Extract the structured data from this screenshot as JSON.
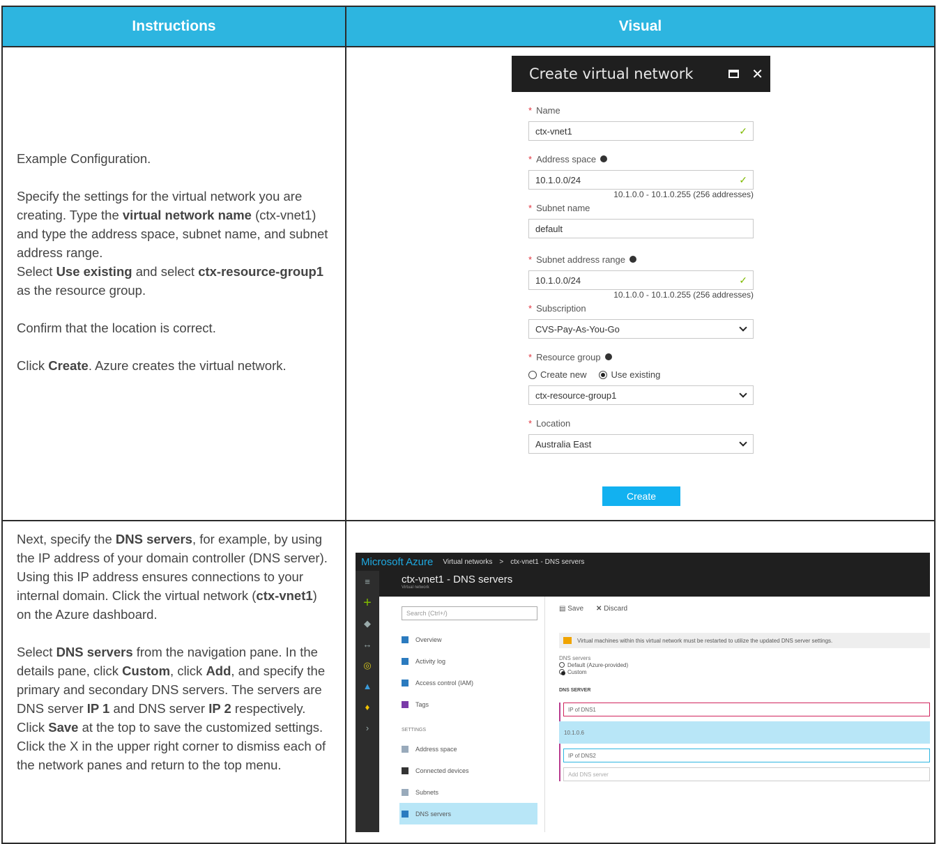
{
  "table": {
    "header": {
      "instructions": "Instructions",
      "visual": "Visual"
    },
    "row1": {
      "p1": "Example Configuration.",
      "p2_a": "Specify the settings for the virtual network you are creating. Type the ",
      "p2_b": "virtual network name",
      "p2_c": " (ctx-vnet1) and type the address space, subnet name, and subnet address range.",
      "p3_a": "Select ",
      "p3_b": "Use existing",
      "p3_c": " and select ",
      "p3_d": "ctx-resource-group1",
      "p3_e": " as the resource group.",
      "p4": "Confirm that the location is correct.",
      "p5_a": "Click ",
      "p5_b": "Create",
      "p5_c": ". Azure creates the virtual network."
    },
    "row2": {
      "p1_a": "Next, specify the ",
      "p1_b": "DNS servers",
      "p1_c": ", for example, by using the IP address of your domain controller (DNS server). Using this IP address ensures connections to your internal domain. Click the virtual network (",
      "p1_d": "ctx-vnet1",
      "p1_e": ") on the Azure dashboard.",
      "p2_a": "Select ",
      "p2_b": "DNS servers",
      "p2_c": " from the navigation pane. In the details pane, click ",
      "p2_d": "Custom",
      "p2_e": ", click ",
      "p2_f": "Add",
      "p2_g": ", and specify the primary and secondary DNS servers. The servers are DNS server ",
      "p2_h": "IP 1",
      "p2_i": " and DNS server ",
      "p2_j": "IP 2",
      "p2_k": " respectively. Click ",
      "p2_l": "Save",
      "p2_m": " at the top to save the customized settings. Click the X in the upper right corner to dismiss each of the network panes and return to the top menu."
    }
  },
  "create_panel": {
    "title": "Create virtual network",
    "name_label": "Name",
    "name_value": "ctx-vnet1",
    "address_label": "Address space",
    "address_value": "10.1.0.0/24",
    "address_hint": "10.1.0.0 - 10.1.0.255 (256 addresses)",
    "subnet_name_label": "Subnet name",
    "subnet_name_value": "default",
    "subnet_range_label": "Subnet address range",
    "subnet_range_value": "10.1.0.0/24",
    "subnet_range_hint": "10.1.0.0 - 10.1.0.255 (256 addresses)",
    "subscription_label": "Subscription",
    "subscription_value": "CVS-Pay-As-You-Go",
    "rg_label": "Resource group",
    "rg_create_new": "Create new",
    "rg_use_existing": "Use existing",
    "rg_value": "ctx-resource-group1",
    "location_label": "Location",
    "location_value": "Australia East",
    "create_button": "Create"
  },
  "dns_screen": {
    "brand": "Microsoft Azure",
    "crumb1": "Virtual networks",
    "crumb_sep": ">",
    "crumb2": "ctx-vnet1 - DNS servers",
    "blade_title": "ctx-vnet1 - DNS servers",
    "blade_subtitle": "Virtual network",
    "search_placeholder": "Search (Ctrl+/)",
    "nav": [
      "Overview",
      "Activity log",
      "Access control (IAM)",
      "Tags"
    ],
    "settings_label": "SETTINGS",
    "nav_settings": [
      "Address space",
      "Connected devices",
      "Subnets",
      "DNS servers"
    ],
    "save": "Save",
    "discard": "Discard",
    "warning": "Virtual machines within this virtual network must be restarted to utilize the updated DNS server settings.",
    "dns_label": "DNS servers",
    "opt_default": "Default (Azure-provided)",
    "opt_custom": "Custom",
    "col_header": "DNS SERVER",
    "row1": "IP of DNS1",
    "row2": "10.1.0.6",
    "row3": "IP of DNS2",
    "row4": "Add DNS server"
  },
  "colors": {
    "header_bg": "#2db5e0",
    "create_button": "#12b1f0",
    "azure_brand": "#1ea9e1"
  }
}
